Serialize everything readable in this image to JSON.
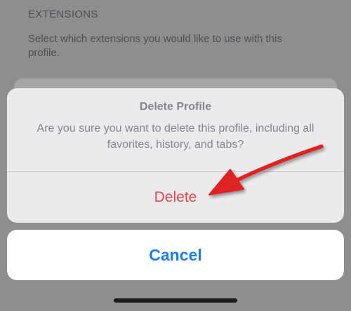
{
  "extensions_section": {
    "header": "EXTENSIONS",
    "description": "Select which extensions you would like to use with this profile."
  },
  "alert": {
    "title": "Delete Profile",
    "message": "Are you sure you want to delete this profile, including all favorites, history, and tabs?",
    "delete_label": "Delete"
  },
  "cancel_label": "Cancel",
  "colors": {
    "destructive": "#e5484d",
    "accent": "#1c7de8",
    "annotation_arrow": "#e02020"
  },
  "annotation": {
    "icon": "red-arrow-pointing-to-delete"
  }
}
